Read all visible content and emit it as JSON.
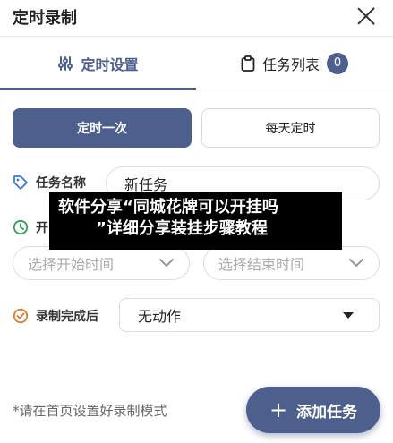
{
  "header": {
    "title": "定时录制"
  },
  "tabs": [
    {
      "label": "定时设置"
    },
    {
      "label": "任务列表",
      "badge": "0"
    }
  ],
  "mode": {
    "once": "定时一次",
    "daily": "每天定时"
  },
  "task_name": {
    "label": "任务名称",
    "value": "新任务"
  },
  "start_time": {
    "label": "开"
  },
  "time": {
    "start_placeholder": "选择开始时间",
    "end_placeholder": "选择结束时间"
  },
  "after_record": {
    "label": "录制完成后",
    "value": "无动作"
  },
  "footer": {
    "note": "*请在首页设置好录制模式",
    "add_button": "添加任务"
  },
  "overlay": {
    "line1": "软件分享“同城花牌可以开挂吗",
    "line2": "”详细分享装挂步骤教程"
  },
  "colors": {
    "accent": "#4d5f8c",
    "tag_icon": "#3a7bd5",
    "clock_icon": "#2e9e55",
    "check_icon": "#e07a2a"
  }
}
